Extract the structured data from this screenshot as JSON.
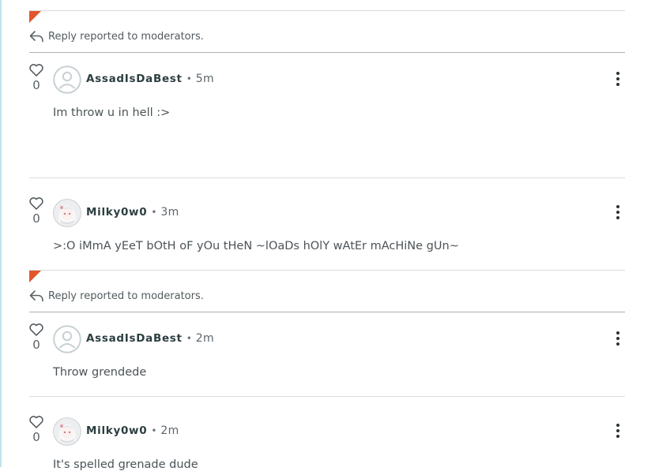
{
  "reported_label": "Reply reported to moderators.",
  "colors": {
    "flag": "#e2552d",
    "divider": "#d9dcdd",
    "report_divider": "#a9b1b5"
  },
  "icons": {
    "like": "heart-icon",
    "reported": "reply-arrow-icon",
    "menu": "kebab-menu-icon",
    "default_avatar": "user-icon"
  },
  "comments": [
    {
      "author": "AssadIsDaBest",
      "time": "5m",
      "likes": "0",
      "text": "Im throw u in hell :>",
      "avatar": "default"
    },
    {
      "author": "Milky0w0",
      "time": "3m",
      "likes": "0",
      "text": ">:O iMmA yEeT bOtH oF yOu tHeN ~lOaDs hOlY wAtEr mAcHiNe gUn~",
      "avatar": "anime"
    },
    {
      "author": "AssadIsDaBest",
      "time": "2m",
      "likes": "0",
      "text": "Throw grendede",
      "avatar": "default"
    },
    {
      "author": "Milky0w0",
      "time": "2m",
      "likes": "0",
      "text": "It's spelled grenade dude",
      "avatar": "anime"
    }
  ]
}
